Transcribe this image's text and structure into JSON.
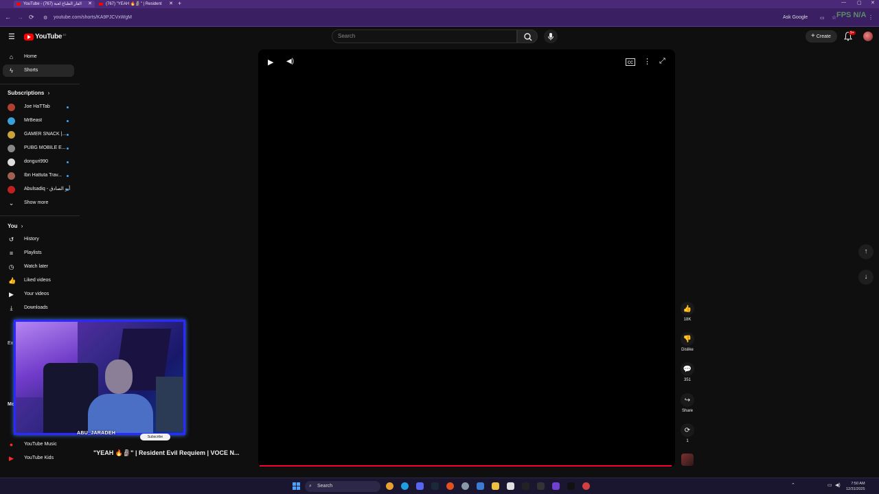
{
  "browser": {
    "tabs": [
      {
        "title": "YouTube - (767) الفار الطباخ لعبة"
      },
      {
        "title": "(767) \"YEAH 🔥🗿\" | Resident"
      }
    ],
    "url": "youtube.com/shorts/KA9PJCVxWgM",
    "ask_google": "Ask Google",
    "new_tab": "+"
  },
  "header": {
    "logo_text": "YouTube",
    "logo_super": "JO",
    "search_placeholder": "Search",
    "create_label": "Create",
    "notif_badge": "9+"
  },
  "sidebar": {
    "main": [
      {
        "label": "Home",
        "icon": "home-icon"
      },
      {
        "label": "Shorts",
        "icon": "shorts-icon",
        "active": true
      }
    ],
    "subscriptions_title": "Subscriptions",
    "subscriptions": [
      {
        "label": "Joe HaTTab",
        "color": "#b04030"
      },
      {
        "label": "MrBeast",
        "color": "#3aa0d8"
      },
      {
        "label": "GAMER SNACK |...",
        "color": "#c9a23a"
      },
      {
        "label": "PUBG MOBILE E...",
        "color": "#888888"
      },
      {
        "label": "donguri990",
        "color": "#dddddd"
      },
      {
        "label": "Ibn Hattuta Trav...",
        "color": "#a06050"
      },
      {
        "label": "Abulsadiq - أبو الصادق",
        "color": "#c02020"
      }
    ],
    "show_more": "Show more",
    "you_title": "You",
    "you_items": [
      {
        "label": "History",
        "icon": "history-icon"
      },
      {
        "label": "Playlists",
        "icon": "playlists-icon"
      },
      {
        "label": "Watch later",
        "icon": "watch-later-icon"
      },
      {
        "label": "Liked videos",
        "icon": "liked-videos-icon"
      },
      {
        "label": "Your videos",
        "icon": "your-videos-icon"
      },
      {
        "label": "Downloads",
        "icon": "downloads-icon"
      }
    ],
    "explore_partial": "Ex",
    "more_partial": "Mc",
    "more_items": [
      {
        "label": "YouTube Music",
        "icon": "youtube-music-icon"
      },
      {
        "label": "YouTube Kids",
        "icon": "youtube-kids-icon"
      }
    ]
  },
  "player": {
    "title": "\"YEAH 🔥🗿\" | Resident Evil Requiem | VOCE N...",
    "progress": 1.0
  },
  "actions": [
    {
      "name": "like",
      "label": "18K",
      "glyph": "👍"
    },
    {
      "name": "dislike",
      "label": "Dislike",
      "glyph": "👎"
    },
    {
      "name": "comments",
      "label": "351",
      "glyph": "💬"
    },
    {
      "name": "share",
      "label": "Share",
      "glyph": "↪"
    },
    {
      "name": "remix",
      "label": "1",
      "glyph": "⟳"
    }
  ],
  "webcam": {
    "name": "ABU_JARADEH",
    "subscribe_label": "Subscribe"
  },
  "taskbar": {
    "search_label": "Search",
    "time": "7:50 AM",
    "date": "12/31/2025"
  },
  "overlay": {
    "fps": "FPS N/A"
  },
  "colors": {
    "accent": "#ff0033",
    "chrome": "#4a2a78"
  }
}
